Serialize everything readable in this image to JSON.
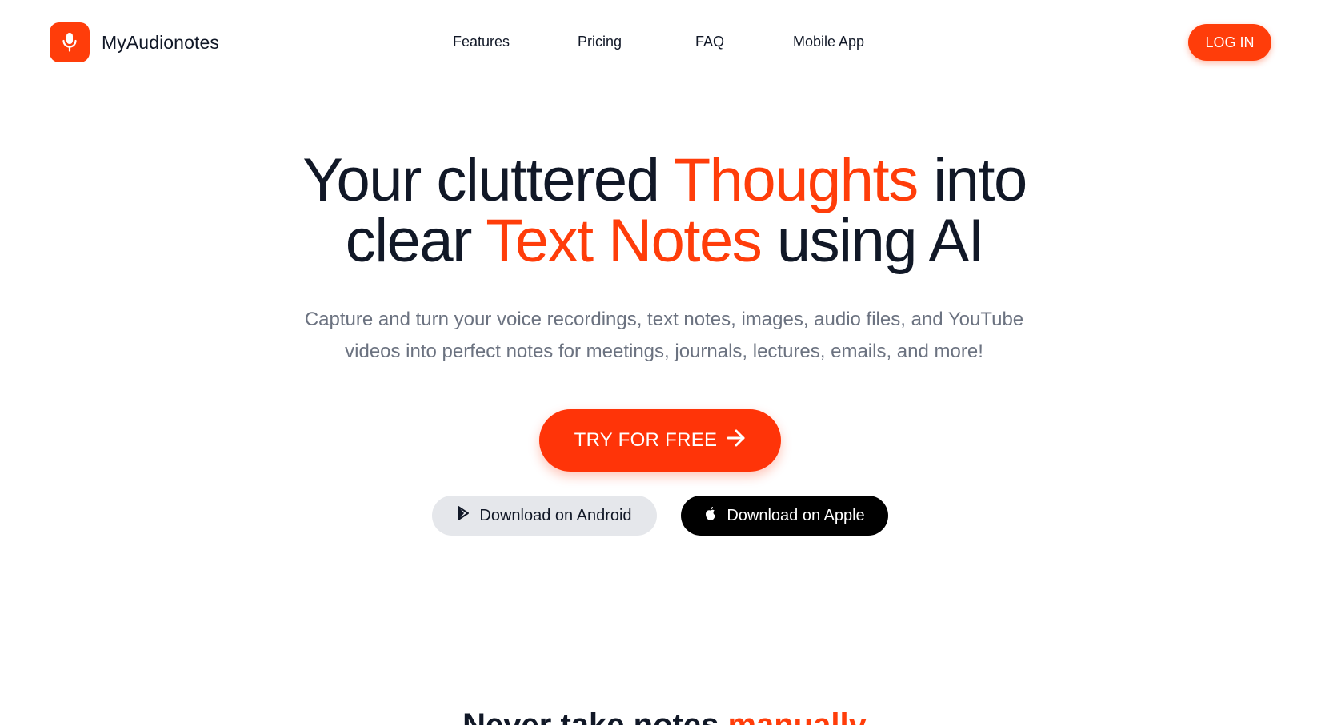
{
  "brand": {
    "name": "MyAudionotes",
    "icon": "microphone-icon",
    "accent_color": "#ff3d0a"
  },
  "nav": {
    "items": [
      {
        "label": "Features"
      },
      {
        "label": "Pricing"
      },
      {
        "label": "FAQ"
      },
      {
        "label": "Mobile App"
      }
    ],
    "login_label": "LOG IN"
  },
  "hero": {
    "title_line1": {
      "pre": "Your cluttered ",
      "highlight": "Thoughts",
      "post": " into"
    },
    "title_line2": {
      "pre": "clear ",
      "highlight": "Text Notes",
      "post": " using AI"
    },
    "subtitle_line1": "Capture and turn your voice recordings, text notes, images, audio files, and YouTube",
    "subtitle_line2": "videos into perfect notes for meetings, journals, lectures, emails, and more!",
    "cta_label": "TRY FOR FREE",
    "cta_icon": "arrow-right-icon",
    "android_label": "Download on Android",
    "android_icon": "play-store-icon",
    "apple_label": "Download on Apple",
    "apple_icon": "apple-icon"
  },
  "next_section": {
    "title_pre": "Never take notes ",
    "title_highlight": "manually"
  }
}
